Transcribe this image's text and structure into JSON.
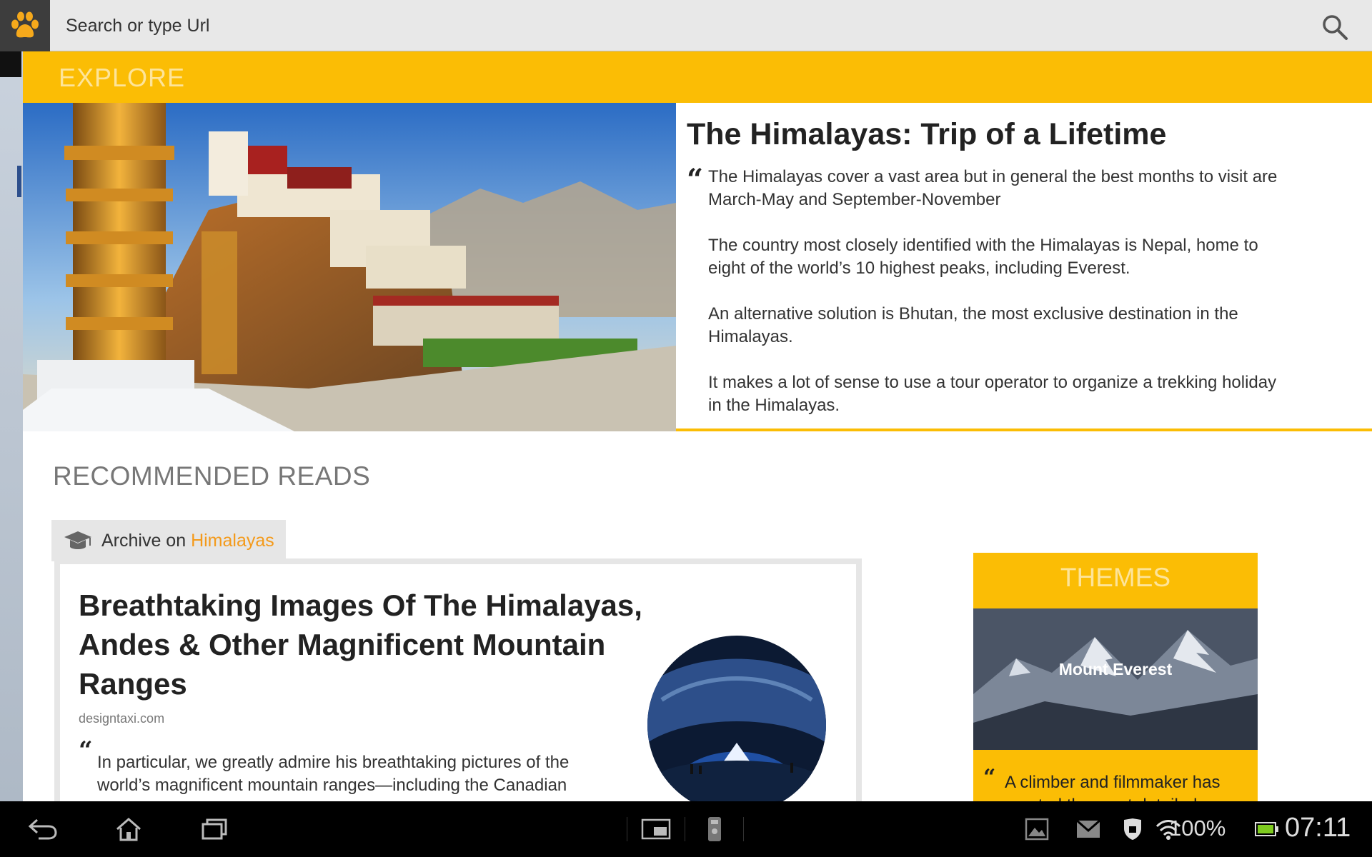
{
  "url_bar": {
    "placeholder": "Search or type Url"
  },
  "explore": {
    "header": "EXPLORE"
  },
  "hero": {
    "title": "The Himalayas: Trip of a Lifetime",
    "quote_mark": "“",
    "paragraphs": [
      "The Himalayas cover a vast area but in general the best months to visit are March-May and September-November",
      "The country most closely identified with the Himalayas is Nepal, home to eight of the world’s 10 highest peaks, including Everest.",
      "An alternative solution is Bhutan, the most exclusive destination in the Himalayas.",
      "It makes a lot of sense to use a tour operator to organize a trekking holiday in the Himalayas."
    ]
  },
  "recommended": {
    "header": "RECOMMENDED READS",
    "tab_prefix": "Archive on",
    "tab_topic": "Himalayas"
  },
  "article": {
    "title": "Breathtaking Images Of The Himalayas, Andes & Other Magnificent Mountain Ranges",
    "source": "designtaxi.com",
    "quote_mark": "“",
    "excerpt": "In particular, we greatly admire his breathtaking pictures of the world’s magnificent mountain ranges—including the Canadian"
  },
  "themes": {
    "header": "THEMES",
    "caption": "Mount Everest",
    "quote_mark": "“",
    "text": "A climber and filmmaker has created the most detailed"
  },
  "status_bar": {
    "battery": "100%",
    "time": "07:11"
  },
  "colors": {
    "accent": "#fbbd05",
    "accent_text": "#fde49a",
    "link": "#f49a1a",
    "nav_bg": "#000000"
  },
  "icons": [
    "paw-logo-icon",
    "search-icon",
    "graduation-cap-icon",
    "back-icon",
    "home-icon",
    "recent-apps-icon",
    "screenshot-icon",
    "remote-icon",
    "gallery-icon",
    "gmail-icon",
    "security-icon",
    "wifi-icon",
    "battery-icon"
  ]
}
